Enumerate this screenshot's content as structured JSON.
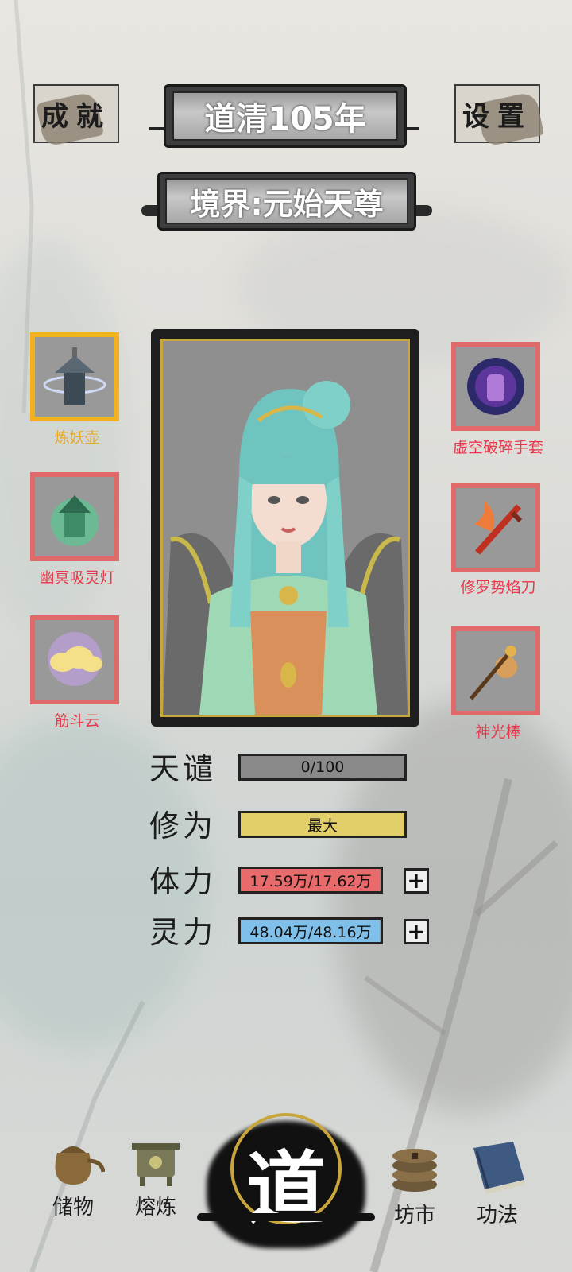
{
  "header": {
    "achievements_label": "成就",
    "year_label": "道清105年",
    "settings_label": "设置",
    "realm_label": "境界:元始天尊"
  },
  "equipment": {
    "left": [
      {
        "label": "炼妖壶",
        "icon": "pagoda-lantern-icon",
        "highlight": true
      },
      {
        "label": "幽冥吸灵灯",
        "icon": "green-lantern-icon",
        "highlight": false
      },
      {
        "label": "筋斗云",
        "icon": "cloud-icon",
        "highlight": false
      }
    ],
    "right": [
      {
        "label": "虚空破碎手套",
        "icon": "void-gauntlet-icon",
        "highlight": false
      },
      {
        "label": "修罗势焰刀",
        "icon": "flame-sword-icon",
        "highlight": false
      },
      {
        "label": "神光棒",
        "icon": "staff-icon",
        "highlight": false
      }
    ]
  },
  "stats": [
    {
      "name": "天谴",
      "value": "0/100",
      "color": "#8a8a8a",
      "fill": 0.0,
      "has_plus": false
    },
    {
      "name": "修为",
      "value": "最大",
      "color": "#e3cf6a",
      "fill": 1.0,
      "has_plus": false
    },
    {
      "name": "体力",
      "value": "17.59万/17.62万",
      "color": "#e86a6a",
      "fill": 0.998,
      "has_plus": true
    },
    {
      "name": "灵力",
      "value": "48.04万/48.16万",
      "color": "#7fc0ea",
      "fill": 0.998,
      "has_plus": true
    }
  ],
  "bottom_nav": {
    "storage": "储物",
    "smelt": "熔炼",
    "dao": "道",
    "market": "坊市",
    "skills": "功法"
  },
  "colors": {
    "slot_border_red": "#e06a6a",
    "slot_border_gold": "#f4b11e",
    "label_red": "#e8364a",
    "label_gold": "#e8a92a"
  }
}
